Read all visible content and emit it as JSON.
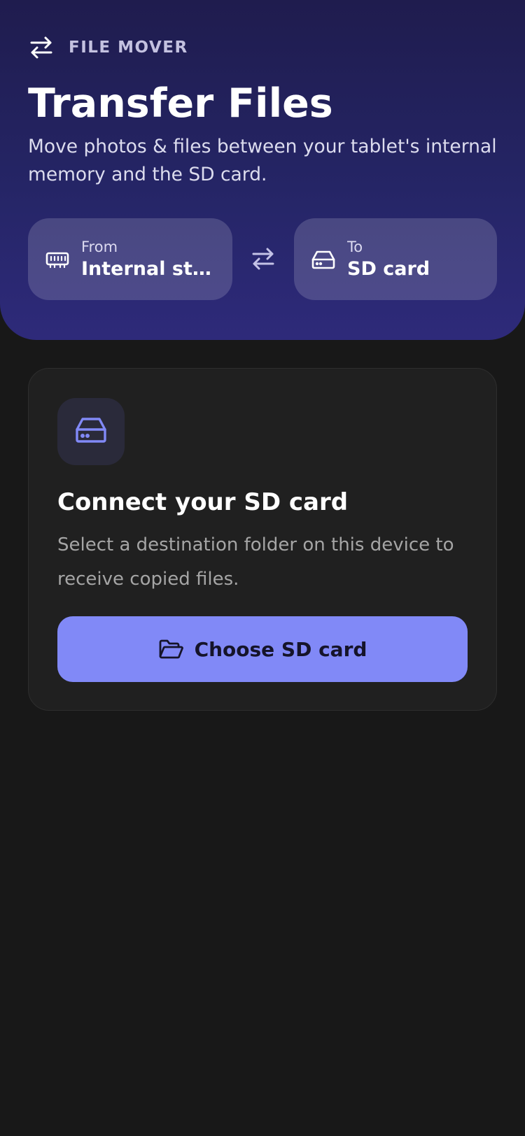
{
  "colors": {
    "header_gradient_top": "#1f1c4e",
    "header_gradient_bottom": "#2e2a7a",
    "background": "#181818",
    "card_background": "#202020",
    "accent": "#8189f7",
    "accent_text": "#15142a"
  },
  "header": {
    "brand_icon": "swap-arrows-icon",
    "brand_label": "FILE MOVER",
    "title": "Transfer Files",
    "subtitle": "Move photos & files between your tablet's internal memory and the SD card."
  },
  "transfer": {
    "from": {
      "icon": "memory-chip-icon",
      "label": "From",
      "value": "Internal storage"
    },
    "swap_icon": "swap-arrows-icon",
    "to": {
      "icon": "drive-icon",
      "label": "To",
      "value": "SD card"
    }
  },
  "card": {
    "icon": "drive-icon",
    "title": "Connect your SD card",
    "description": "Select a destination folder on this device to receive copied files.",
    "button": {
      "icon": "folder-open-icon",
      "label": "Choose SD card"
    }
  }
}
